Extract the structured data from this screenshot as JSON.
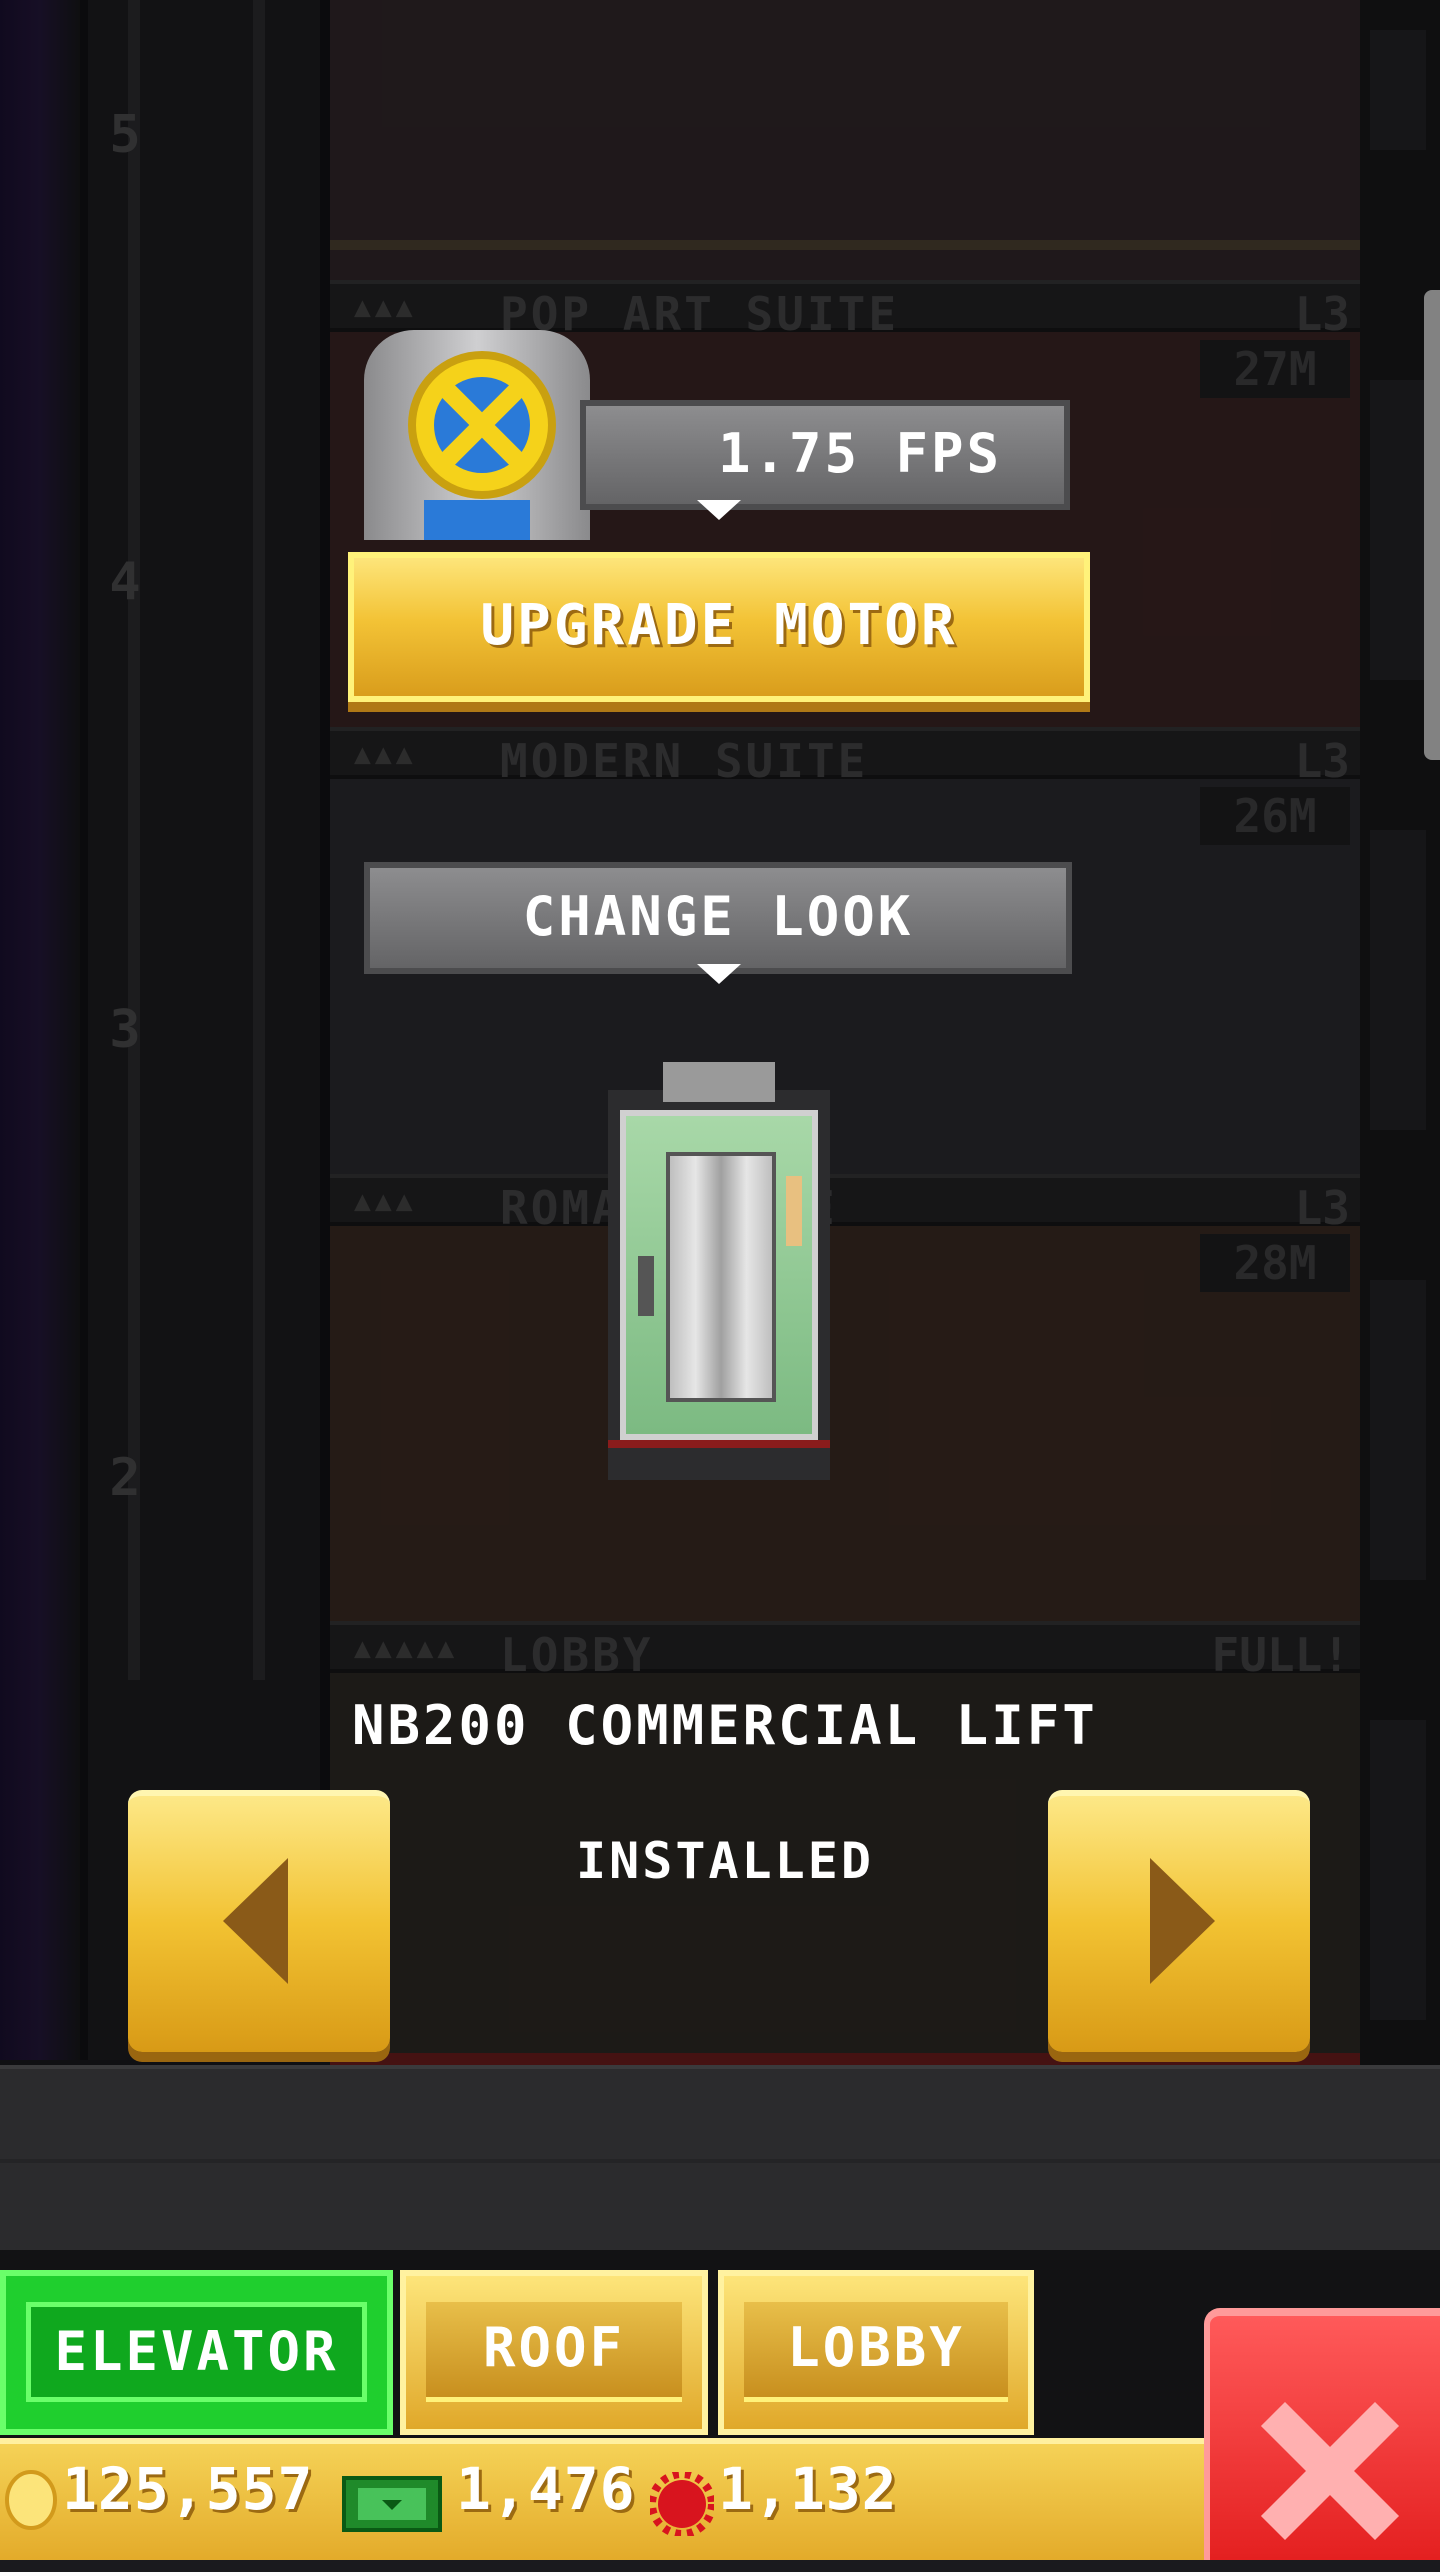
{
  "shaft": {
    "floor_numbers": [
      "5",
      "4",
      "3",
      "2"
    ]
  },
  "floors": [
    {
      "people": "▲▲▲",
      "name": "POP ART SUITE",
      "level": "L3",
      "price": "27M"
    },
    {
      "people": "▲▲▲",
      "name": "MODERN SUITE",
      "level": "L3",
      "price": "26M"
    },
    {
      "people": "▲▲▲",
      "name": "ROMAN SUITE",
      "level": "L3",
      "price": "28M"
    },
    {
      "people": "▲▲▲▲▲",
      "name": "LOBBY",
      "level": "FULL!"
    }
  ],
  "motor": {
    "speed_label": "1.75 FPS",
    "upgrade_label": "UPGRADE MOTOR"
  },
  "elevator": {
    "change_look_label": "CHANGE LOOK",
    "model_name": "NB200 COMMERCIAL LIFT",
    "status": "INSTALLED"
  },
  "icons": {
    "motor": "motor-reel-icon",
    "prev": "arrow-left-icon",
    "next": "arrow-right-icon",
    "coin": "coin-icon",
    "bux": "tower-bux-icon",
    "gem": "gear-gem-icon",
    "close": "close-x-icon"
  },
  "tabs": [
    {
      "label": "ELEVATOR",
      "active": true
    },
    {
      "label": "ROOF",
      "active": false
    },
    {
      "label": "LOBBY",
      "active": false
    }
  ],
  "currency": {
    "coins": "125,557",
    "bux": "1,476",
    "gems": "1,132"
  },
  "colors": {
    "gold": "#f2c232",
    "active_tab": "#1fcf2e",
    "close": "#e42020"
  }
}
